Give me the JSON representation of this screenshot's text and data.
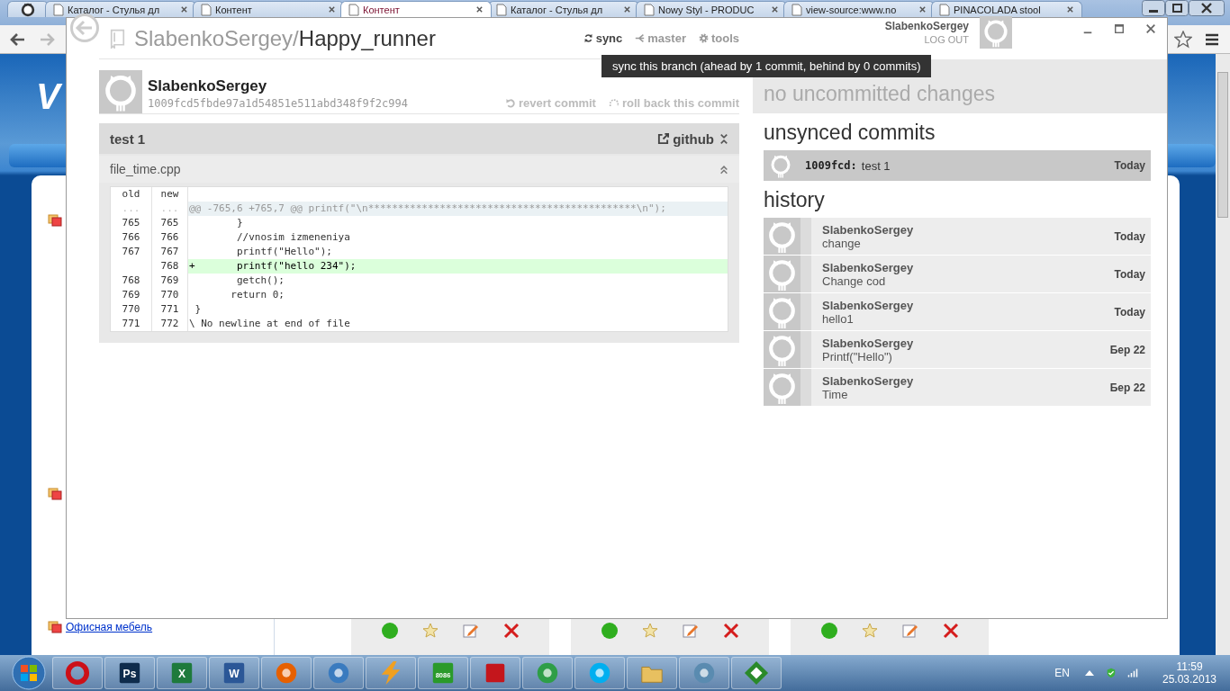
{
  "browser": {
    "tabs": [
      {
        "kind": "pinned",
        "selected": false
      },
      {
        "kind": "page",
        "title": "Каталог - Стулья дл",
        "selected": false
      },
      {
        "kind": "page",
        "title": "Контент",
        "selected": false
      },
      {
        "kind": "page",
        "title": "Контент",
        "selected": true
      },
      {
        "kind": "page",
        "title": "Каталог - Стулья дл",
        "selected": false
      },
      {
        "kind": "page",
        "title": "Nowy Styl - PRODUC",
        "selected": false
      },
      {
        "kind": "page",
        "title": "view-source:www.no",
        "selected": false
      },
      {
        "kind": "page",
        "title": "PINACOLADA stool",
        "selected": false
      }
    ]
  },
  "page": {
    "logo": "V",
    "sidebar_link": "Офисная мебель"
  },
  "app": {
    "owner": "SlabenkoSergey/",
    "repo": "Happy_runner",
    "nav": [
      {
        "label": "sync",
        "kind": "sync"
      },
      {
        "label": "master",
        "kind": "branch"
      },
      {
        "label": "tools",
        "kind": "gear"
      }
    ],
    "user": {
      "name": "SlabenkoSergey",
      "logout": "LOG OUT"
    },
    "tooltip": "sync this branch (ahead by 1 commit, behind by 0 commits)",
    "commit": {
      "author": "SlabenkoSergey",
      "sha": "1009fcd5fbde97a1d54851e511abd348f9f2c994",
      "actions": [
        {
          "label": "revert commit",
          "kind": "revert"
        },
        {
          "label": "roll back this commit",
          "kind": "rollback"
        }
      ],
      "message": "test 1",
      "link": "github"
    },
    "file": {
      "name": "file_time.cpp",
      "columns": [
        "old",
        "new"
      ],
      "lines": [
        {
          "kind": "hunk",
          "old": "...",
          "new": "...",
          "text": "@@ -765,6 +765,7 @@ printf(\"\\n*********************************************\\n\");"
        },
        {
          "kind": "context",
          "old": "765",
          "new": "765",
          "text": "        }"
        },
        {
          "kind": "context",
          "old": "766",
          "new": "766",
          "text": "        //vnosim izmeneniya"
        },
        {
          "kind": "context",
          "old": "767",
          "new": "767",
          "text": "        printf(\"Hello\");"
        },
        {
          "kind": "add",
          "new": "768",
          "text": "+       printf(\"hello 234\");"
        },
        {
          "kind": "context",
          "old": "768",
          "new": "769",
          "text": "        getch();"
        },
        {
          "kind": "context",
          "old": "769",
          "new": "770",
          "text": "       return 0;"
        },
        {
          "kind": "context",
          "old": "770",
          "new": "771",
          "text": " }"
        },
        {
          "kind": "context",
          "old": "771",
          "new": "772",
          "text": "\\ No newline at end of file"
        }
      ]
    },
    "status": "no uncommitted changes",
    "unsynced": {
      "title": "unsynced commits",
      "commits": [
        {
          "sha": "1009fcd:",
          "message": "test 1",
          "date": "Today"
        }
      ]
    },
    "history": {
      "title": "history",
      "commits": [
        {
          "author": "SlabenkoSergey",
          "message": "change",
          "date": "Today"
        },
        {
          "author": "SlabenkoSergey",
          "message": "Change cod",
          "date": "Today"
        },
        {
          "author": "SlabenkoSergey",
          "message": "hello1",
          "date": "Today"
        },
        {
          "author": "SlabenkoSergey",
          "message": "Printf(\"Hello\")",
          "date": "Бер 22"
        },
        {
          "author": "SlabenkoSergey",
          "message": "Time",
          "date": "Бер 22"
        }
      ]
    }
  },
  "taskbar": {
    "apps": [
      {
        "kind": "ring",
        "color": "#cc1018"
      },
      {
        "kind": "tile",
        "label": "Ps",
        "color": "#0f2c4c"
      },
      {
        "kind": "tile",
        "label": "X",
        "color": "#1e7a3c"
      },
      {
        "kind": "tile",
        "label": "W",
        "color": "#2b5797"
      },
      {
        "kind": "ball",
        "color": "#e66000"
      },
      {
        "kind": "ball",
        "color": "#3a7bbf"
      },
      {
        "kind": "bolt",
        "color": "#f0a020"
      },
      {
        "kind": "tile",
        "label": "8086",
        "color": "#2a9a2a"
      },
      {
        "kind": "square",
        "color": "#c4161c"
      },
      {
        "kind": "ball",
        "color": "#2e9e47"
      },
      {
        "kind": "ball",
        "color": "#00aff0"
      },
      {
        "kind": "folder",
        "color": "#e8c060"
      },
      {
        "kind": "ball",
        "color": "#5a8bb0"
      },
      {
        "kind": "diamond",
        "color": "#2a8a2a"
      }
    ],
    "tray": {
      "language": "EN",
      "time": "11:59",
      "date": "25.03.2013"
    }
  }
}
